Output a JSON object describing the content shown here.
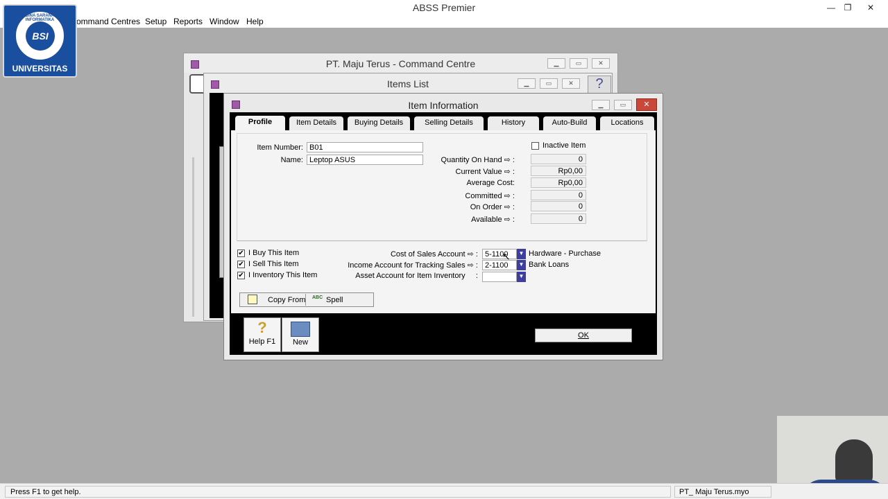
{
  "app": {
    "title": "ABSS Premier",
    "min": "—",
    "restore": "❐",
    "close": "✕"
  },
  "menu": {
    "command_centres": "ommand Centres",
    "setup": "Setup",
    "reports": "Reports",
    "window": "Window",
    "help": "Help"
  },
  "logo": {
    "ring_text": "BINA SARANA INFORMATIKA",
    "mark": "BSI",
    "text": "UNIVERSITAS"
  },
  "command_centre": {
    "title": "PT. Maju Terus - Command Centre"
  },
  "items_list": {
    "title": "Items List"
  },
  "dialog": {
    "title": "Item Information",
    "tabs": [
      "Profile",
      "Item Details",
      "Buying Details",
      "Selling Details",
      "History",
      "Auto-Build",
      "Locations"
    ],
    "item_number_label": "Item Number:",
    "item_number_value": "B01",
    "name_label": "Name:",
    "name_value": "Leptop ASUS",
    "inactive_label": "Inactive Item",
    "inactive_checked": false,
    "stats": [
      {
        "label": "Quantity On Hand",
        "value": "0",
        "arrow": true
      },
      {
        "label": "Current Value",
        "value": "Rp0,00",
        "arrow": true
      },
      {
        "label": "Average Cost:",
        "value": "Rp0,00",
        "arrow": false
      },
      {
        "label": "Committed",
        "value": "0",
        "arrow": true
      },
      {
        "label": "On Order",
        "value": "0",
        "arrow": true
      },
      {
        "label": "Available",
        "value": "0",
        "arrow": true
      }
    ],
    "checks": [
      {
        "label": "I Buy This Item",
        "checked": true
      },
      {
        "label": "I Sell This Item",
        "checked": true
      },
      {
        "label": "I Inventory This Item",
        "checked": true
      }
    ],
    "accounts": [
      {
        "label": "Cost of Sales Account",
        "value": "5-1100",
        "name": "Hardware - Purchase"
      },
      {
        "label": "Income Account for Tracking Sales",
        "value": "2-1100",
        "name": "Bank Loans"
      },
      {
        "label": "Asset Account for Item Inventory",
        "value": "",
        "name": ""
      }
    ],
    "copy_from": "Copy From",
    "spell": "Spell",
    "help_f1": "Help F1",
    "new": "New",
    "ok": "OK"
  },
  "status": {
    "left": "Press F1 to get help.",
    "right": "PT_ Maju Terus.myo"
  }
}
